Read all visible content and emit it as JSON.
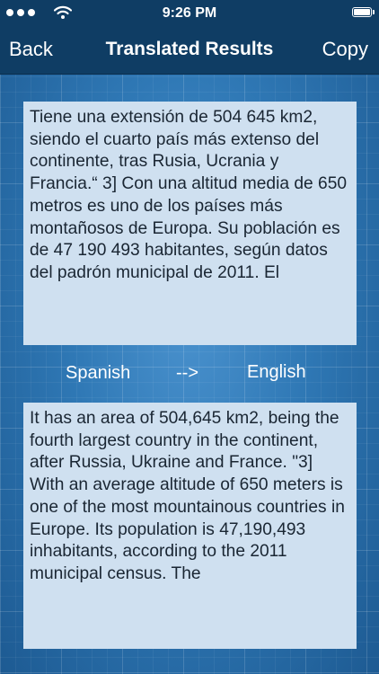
{
  "status_bar": {
    "time": "9:26 PM",
    "signal_icon": "signal-dots-icon",
    "wifi_icon": "wifi-icon",
    "battery_icon": "battery-icon"
  },
  "nav": {
    "back_label": "Back",
    "title": "Translated Results",
    "copy_label": "Copy"
  },
  "source": {
    "language": "Spanish",
    "text": "Tiene una extensión de 504 645 km2, siendo el cuarto país más extenso del continente, tras Rusia, Ucrania y Francia.“ 3] Con una altitud media de 650 metros es uno de los países más montañosos de Europa. Su población es de 47 190 493 habitantes, según datos del padrón municipal de 2011. El"
  },
  "arrow": "-->",
  "target": {
    "language": "English",
    "text": "It has an area of 504,645 km2, being the fourth largest country in the continent, after Russia, Ukraine and France. \"3] With an average altitude of 650 meters is one of the most mountainous countries in Europe. Its population is 47,190,493 inhabitants, according to the 2011 municipal census. The"
  },
  "colors": {
    "nav_background": "#0f3d64",
    "panel_background": "#cfe0f0",
    "background_blue": "#2f78b5",
    "text_dark": "#1a2633"
  }
}
